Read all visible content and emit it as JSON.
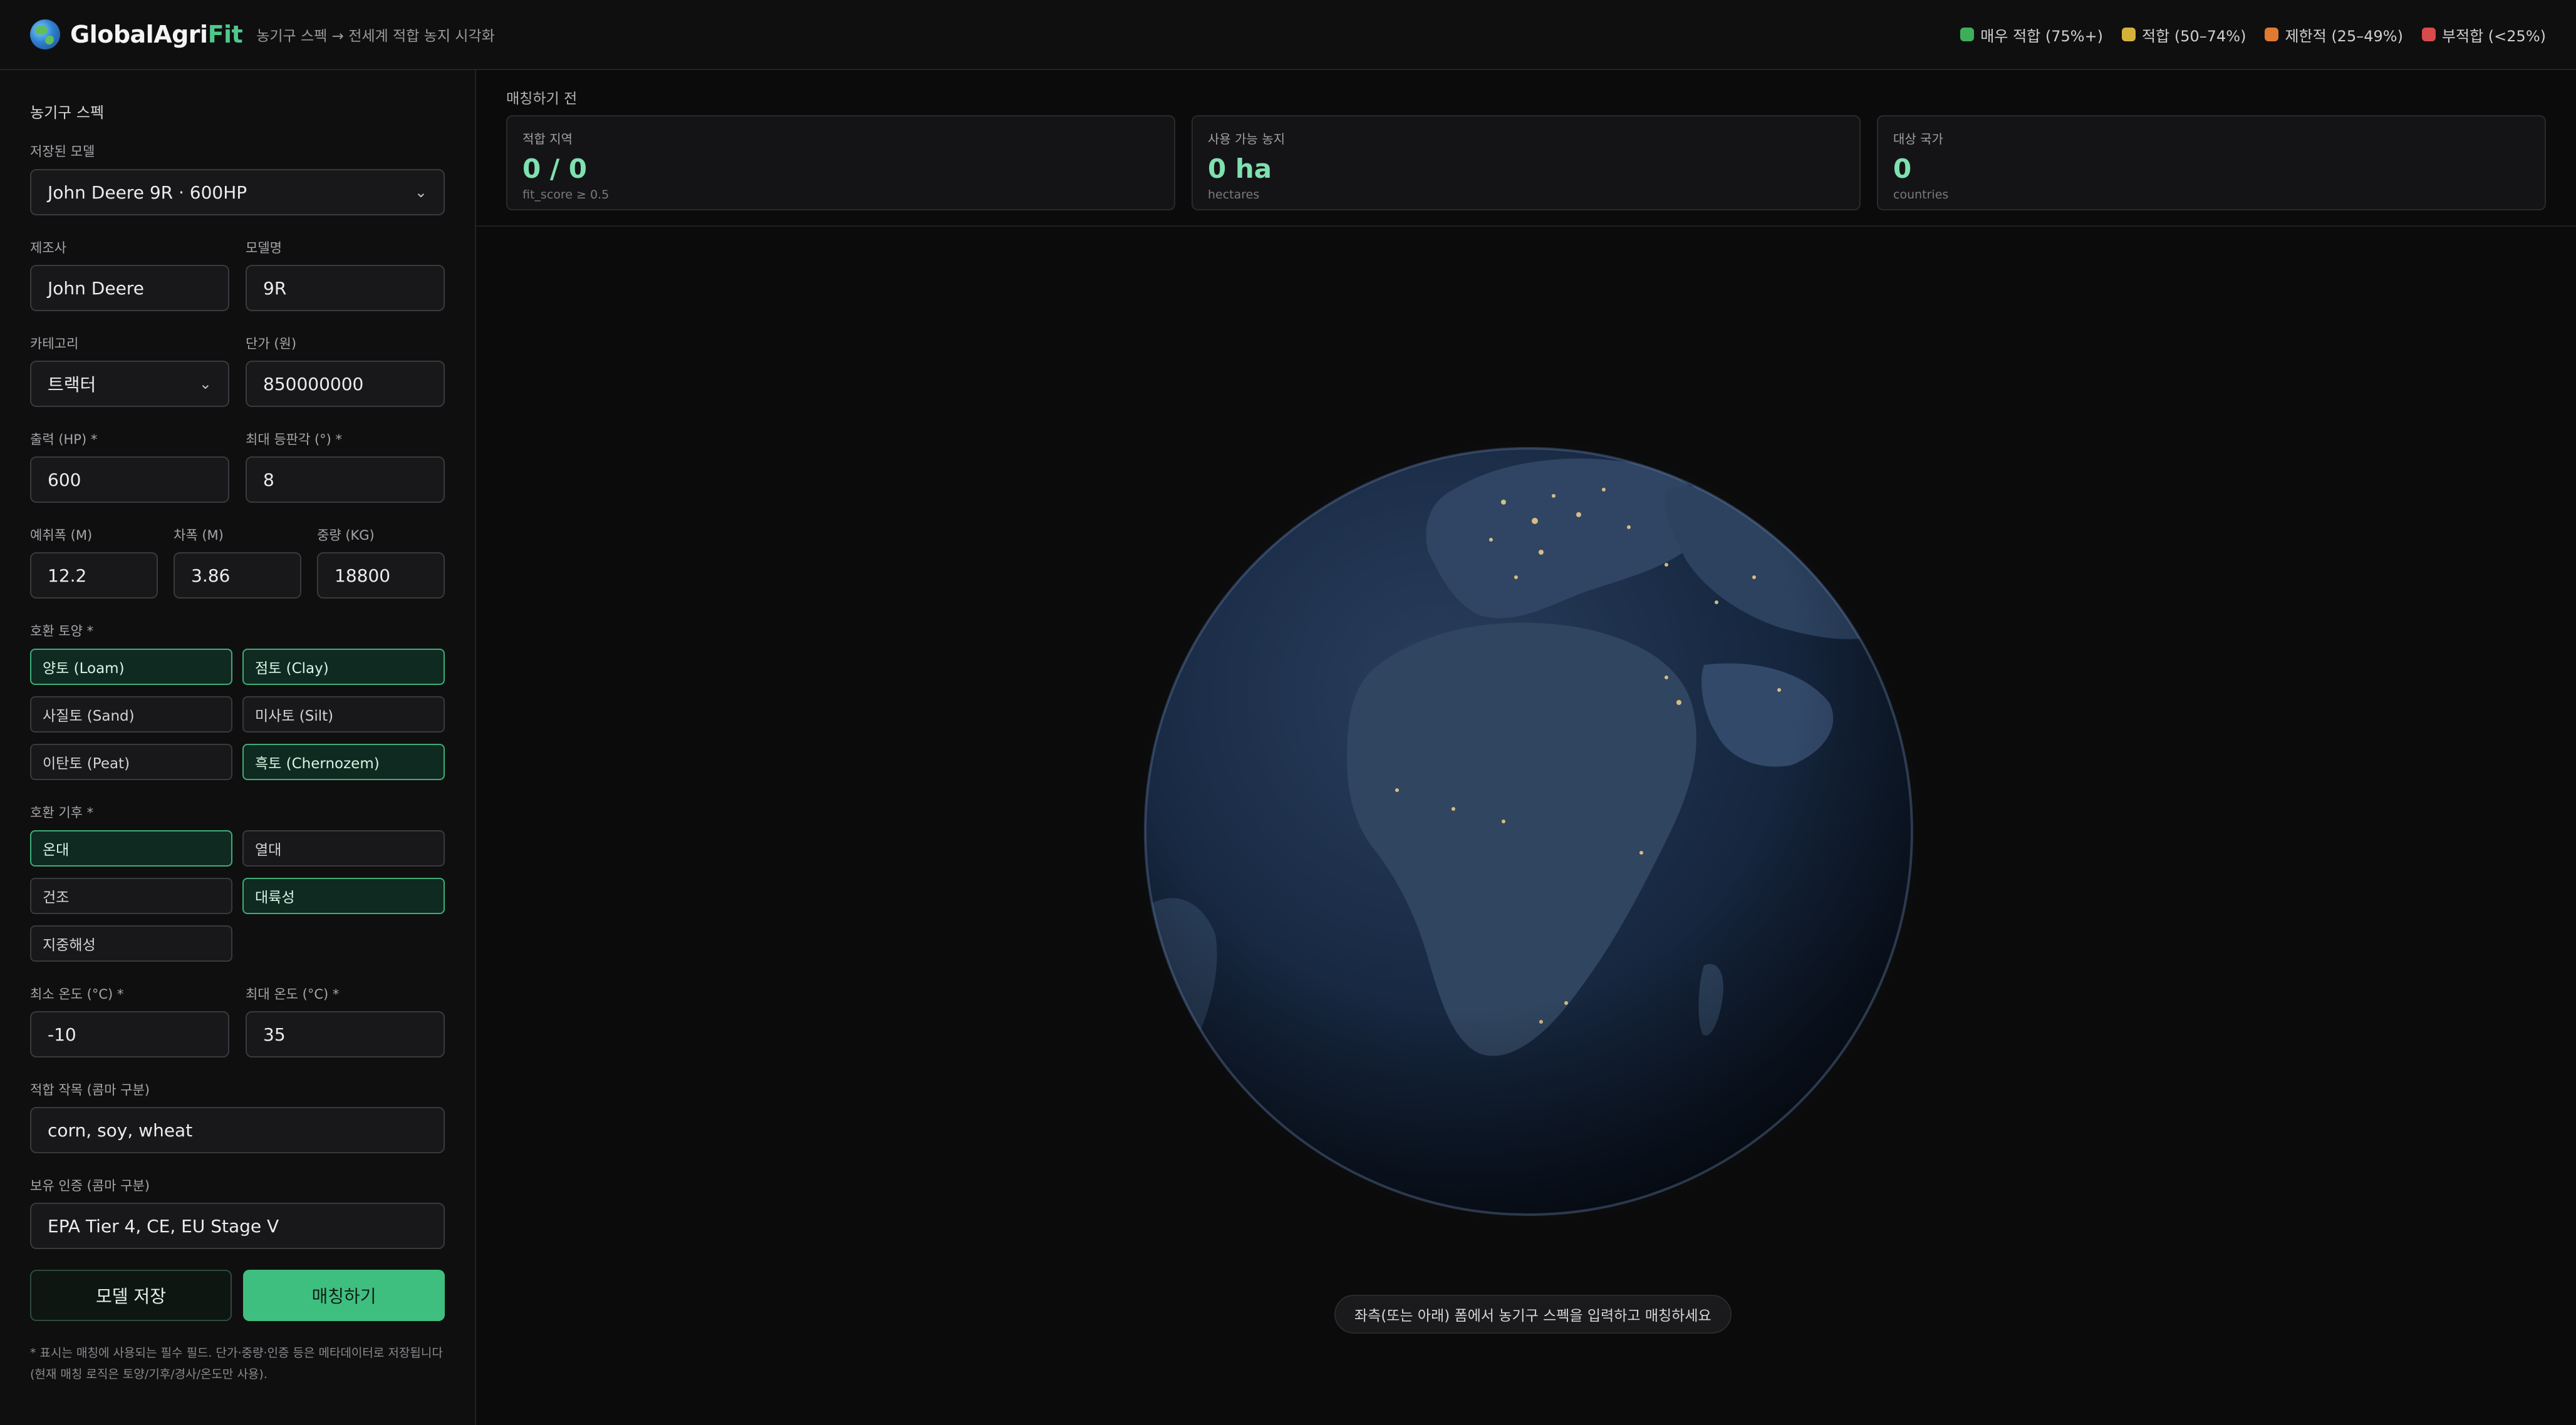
{
  "header": {
    "brand_main": "GlobalAgri",
    "brand_accent": "Fit",
    "tagline": "농기구 스펙 → 전세계 적합 농지 시각화",
    "legend": [
      {
        "label": "매우 적합 (75%+)",
        "color": "#3fae5a"
      },
      {
        "label": "적합 (50–74%)",
        "color": "#d4b23a"
      },
      {
        "label": "제한적 (25–49%)",
        "color": "#e07a32"
      },
      {
        "label": "부적합 (<25%)",
        "color": "#d94a4a"
      }
    ]
  },
  "sidebar": {
    "title": "농기구 스펙",
    "saved_model": {
      "label": "저장된 모델",
      "value": "John Deere 9R · 600HP"
    },
    "manufacturer": {
      "label": "제조사",
      "value": "John Deere"
    },
    "model_name": {
      "label": "모델명",
      "value": "9R"
    },
    "category": {
      "label": "카테고리",
      "value": "트랙터"
    },
    "unit_price": {
      "label": "단가 (원)",
      "value": "850000000"
    },
    "power": {
      "label": "출력 (HP) *",
      "value": "600"
    },
    "max_slope": {
      "label": "최대 등판각 (°) *",
      "value": "8"
    },
    "working_width": {
      "label": "예취폭 (M)",
      "value": "12.2"
    },
    "vehicle_width": {
      "label": "차폭 (M)",
      "value": "3.86"
    },
    "weight": {
      "label": "중량 (KG)",
      "value": "18800"
    },
    "soils": {
      "label": "호환 토양 *",
      "items": [
        {
          "label": "양토 (Loam)",
          "selected": true
        },
        {
          "label": "점토 (Clay)",
          "selected": true
        },
        {
          "label": "사질토 (Sand)",
          "selected": false
        },
        {
          "label": "미사토 (Silt)",
          "selected": false
        },
        {
          "label": "이탄토 (Peat)",
          "selected": false
        },
        {
          "label": "흑토 (Chernozem)",
          "selected": true
        }
      ]
    },
    "climates": {
      "label": "호환 기후 *",
      "items": [
        {
          "label": "온대",
          "selected": true
        },
        {
          "label": "열대",
          "selected": false
        },
        {
          "label": "건조",
          "selected": false
        },
        {
          "label": "대륙성",
          "selected": true
        },
        {
          "label": "지중해성",
          "selected": false
        }
      ]
    },
    "min_temp": {
      "label": "최소 온도 (°C) *",
      "value": "-10"
    },
    "max_temp": {
      "label": "최대 온도 (°C) *",
      "value": "35"
    },
    "crops": {
      "label": "적합 작목 (콤마 구분)",
      "value": "corn, soy, wheat"
    },
    "certs": {
      "label": "보유 인증 (콤마 구분)",
      "value": "EPA Tier 4, CE, EU Stage V"
    },
    "save_button": "모델 저장",
    "match_button": "매칭하기",
    "footnote_line1": "* 표시는 매칭에 사용되는 필수 필드. 단가·중량·인증 등은 메타데이터로 저장됩니다",
    "footnote_line2": "(현재 매칭 로직은 토양/기후/경사/온도만 사용)."
  },
  "main": {
    "status": "매칭하기 전",
    "stats": [
      {
        "label": "적합 지역",
        "value": "0 / 0",
        "sub": "fit_score ≥ 0.5"
      },
      {
        "label": "사용 가능 농지",
        "value": "0 ha",
        "sub": "hectares"
      },
      {
        "label": "대상 국가",
        "value": "0",
        "sub": "countries"
      }
    ],
    "hint": "좌측(또는 아래) 폼에서 농기구 스펙을 입력하고 매칭하세요"
  },
  "colors": {
    "accent": "#3fbf7f",
    "accent_text": "#7fe0b0",
    "selected_border": "#3fae78"
  }
}
